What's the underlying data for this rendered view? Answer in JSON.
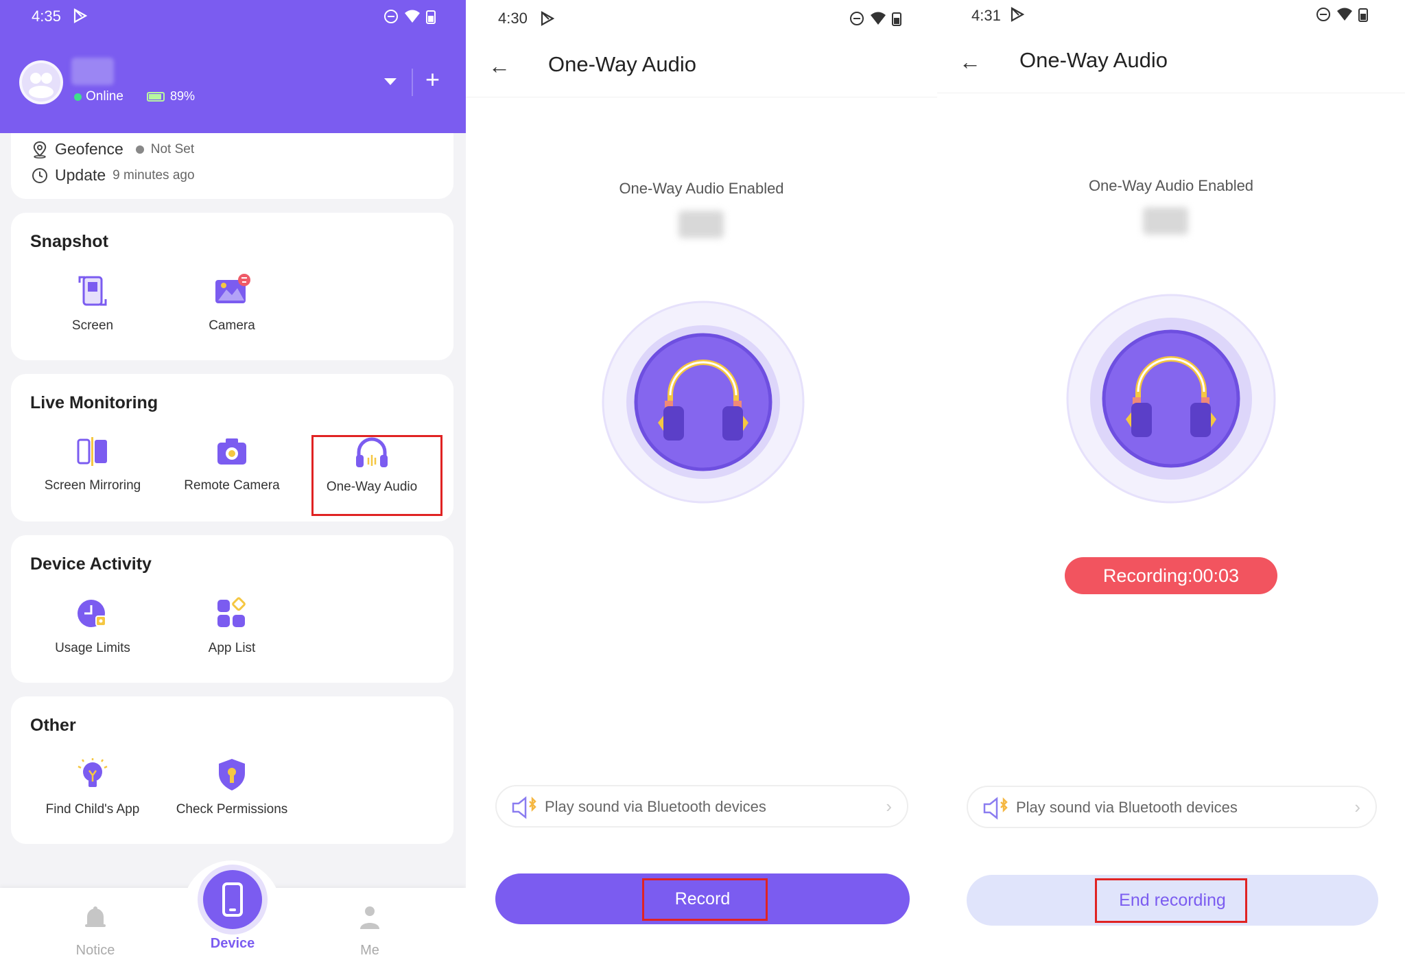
{
  "colors": {
    "accent": "#7b5cf0",
    "highlight": "#e02323",
    "recording": "#f2545f",
    "online": "#3fe08a"
  },
  "panel_device": {
    "status_time": "4:35",
    "online_label": "Online",
    "battery_label": "89%",
    "geofence_label": "Geofence",
    "geofence_value": "Not Set",
    "update_label": "Update",
    "update_value": "9 minutes ago",
    "sections": {
      "snapshot": {
        "title": "Snapshot",
        "screen": "Screen",
        "camera": "Camera"
      },
      "live": {
        "title": "Live Monitoring",
        "mirroring": "Screen Mirroring",
        "remote_camera": "Remote Camera",
        "one_way_audio": "One-Way Audio"
      },
      "activity": {
        "title": "Device Activity",
        "usage_limits": "Usage Limits",
        "app_list": "App List"
      },
      "other": {
        "title": "Other",
        "find_app": "Find Child's App",
        "permissions": "Check Permissions"
      }
    },
    "nav": {
      "notice": "Notice",
      "device": "Device",
      "me": "Me"
    }
  },
  "panel_audio_idle": {
    "status_time": "4:30",
    "title": "One-Way Audio",
    "enabled_label": "One-Way Audio Enabled",
    "bluetooth_label": "Play sound via Bluetooth devices",
    "button_label": "Record"
  },
  "panel_audio_recording": {
    "status_time": "4:31",
    "title": "One-Way Audio",
    "enabled_label": "One-Way Audio Enabled",
    "recording_label": "Recording:00:03",
    "bluetooth_label": "Play sound via Bluetooth devices",
    "button_label": "End recording"
  }
}
